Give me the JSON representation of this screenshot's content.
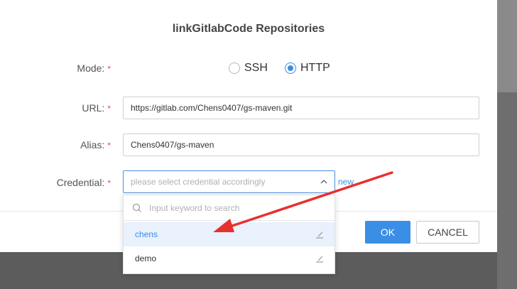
{
  "dialog": {
    "title": "linkGitlabCode Repositories"
  },
  "form": {
    "mode": {
      "label": "Mode:",
      "options": [
        {
          "label": "SSH",
          "checked": false
        },
        {
          "label": "HTTP",
          "checked": true
        }
      ]
    },
    "url": {
      "label": "URL:",
      "value": "https://gitlab.com/Chens0407/gs-maven.git"
    },
    "alias": {
      "label": "Alias:",
      "value": "Chens0407/gs-maven"
    },
    "credential": {
      "label": "Credential:",
      "placeholder": "please select credential accordingly",
      "new_link": "new",
      "search_placeholder": "Input keyword to search",
      "items": [
        {
          "label": "chens",
          "highlighted": true
        },
        {
          "label": "demo",
          "highlighted": false
        }
      ]
    },
    "required_mark": "*"
  },
  "footer": {
    "ok_label": "OK",
    "cancel_label": "CANCEL"
  },
  "colors": {
    "accent": "#3a8ee6",
    "required": "#e84a4a",
    "annotation_arrow": "#e8302f"
  }
}
